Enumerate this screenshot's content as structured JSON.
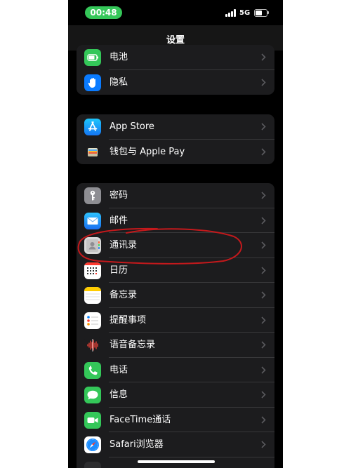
{
  "status_bar": {
    "time": "00:48",
    "network": "5G",
    "battery_level": 0.6
  },
  "nav": {
    "title": "设置"
  },
  "colors": {
    "background": "#000000",
    "cell": "#1c1c1e",
    "separator": "#38383a",
    "accent_green": "#35c759",
    "annotation_red": "#c4191c"
  },
  "groups": [
    {
      "items": [
        {
          "label": "电池",
          "icon": "battery-icon"
        },
        {
          "label": "隐私",
          "icon": "hand-icon"
        }
      ]
    },
    {
      "items": [
        {
          "label": "App Store",
          "icon": "app-store-icon"
        },
        {
          "label": "钱包与 Apple Pay",
          "icon": "wallet-icon"
        }
      ]
    },
    {
      "items": [
        {
          "label": "密码",
          "icon": "key-icon"
        },
        {
          "label": "邮件",
          "icon": "mail-icon"
        },
        {
          "label": "通讯录",
          "icon": "contacts-icon"
        },
        {
          "label": "日历",
          "icon": "calendar-icon"
        },
        {
          "label": "备忘录",
          "icon": "notes-icon"
        },
        {
          "label": "提醒事项",
          "icon": "reminders-icon"
        },
        {
          "label": "语音备忘录",
          "icon": "voice-memos-icon"
        },
        {
          "label": "电话",
          "icon": "phone-icon"
        },
        {
          "label": "信息",
          "icon": "messages-icon"
        },
        {
          "label": "FaceTime通话",
          "icon": "facetime-icon"
        },
        {
          "label": "Safari浏览器",
          "icon": "safari-icon"
        }
      ]
    }
  ]
}
